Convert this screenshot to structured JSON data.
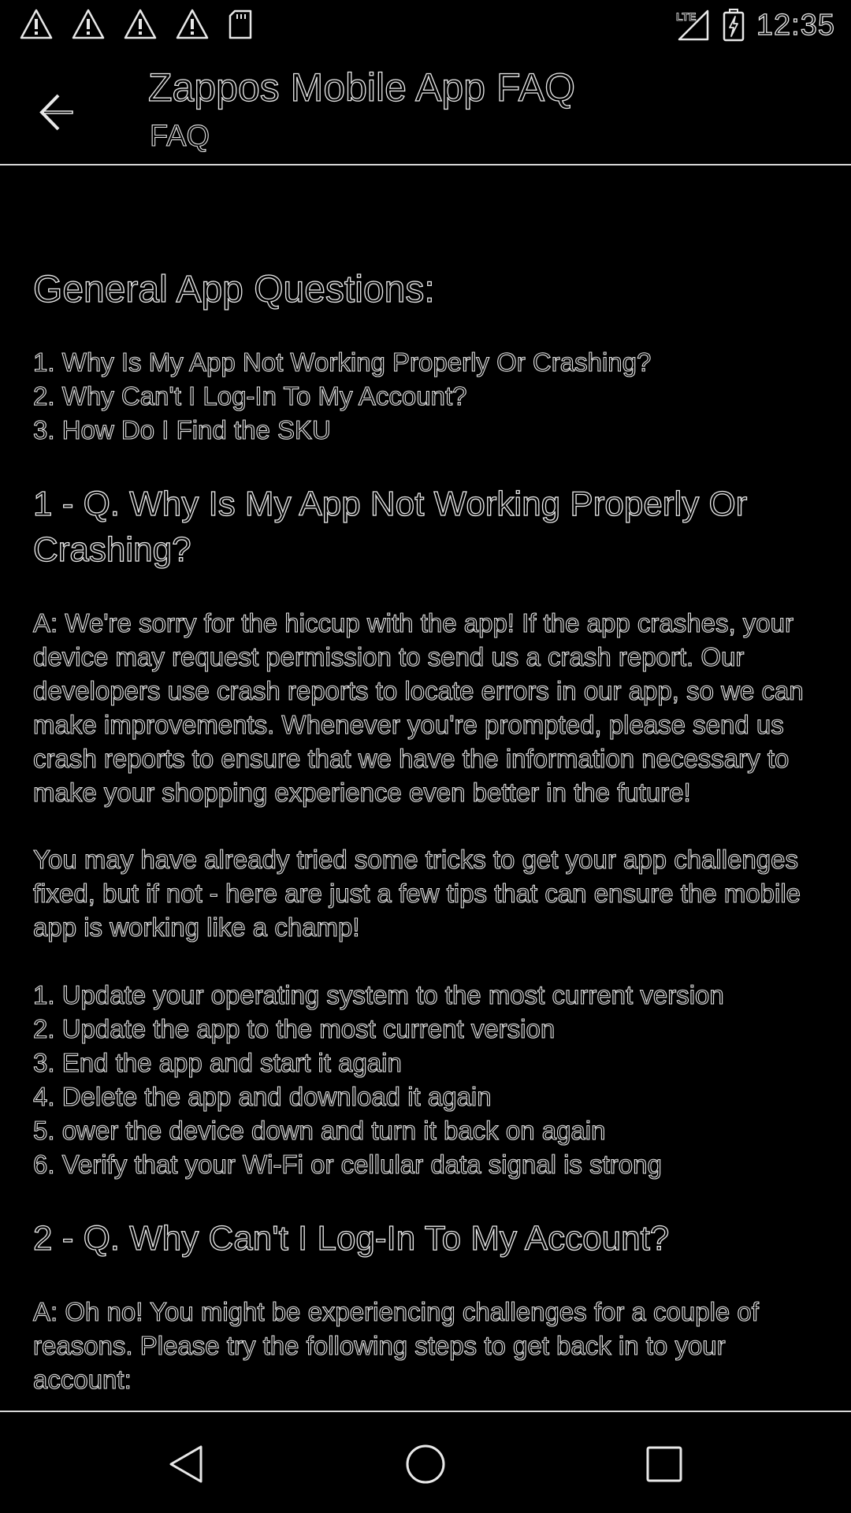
{
  "status_bar": {
    "time": "12:35",
    "notification_icons": [
      "warning-icon",
      "warning-icon",
      "warning-icon",
      "warning-icon",
      "sd-card-icon"
    ],
    "signal_label": "LTE"
  },
  "app_bar": {
    "title": "Zappos Mobile App FAQ",
    "subtitle": "FAQ"
  },
  "content": {
    "section_title": "General App Questions:",
    "toc": [
      "1. Why Is My App Not Working Properly Or Crashing?",
      "2. Why Can't I Log-In To My Account?",
      "3. How Do I Find the SKU"
    ],
    "q1": {
      "title": "1 - Q. Why Is My App Not Working Properly Or Crashing?",
      "answer_1": "A: We're sorry for the hiccup with the app! If the app crashes, your device may request permission to send us a crash report. Our developers use crash reports to locate errors in our app, so we can make improvements. Whenever you're prompted, please send us crash reports to ensure that we have the information necessary to make your shopping experience even better in the future!",
      "answer_2": "You may have already tried some tricks to get your app challenges fixed, but if not - here are just a few tips that can ensure the mobile app is working like a champ!",
      "tips": [
        "1. Update your operating system to the most current version",
        "2. Update the app to the most current version",
        "3. End the app and start it again",
        "4. Delete the app and download it again",
        "5. ower the device down and turn it back on again",
        "6. Verify that your Wi-Fi or cellular data signal is strong"
      ]
    },
    "q2": {
      "title": "2 - Q. Why Can't I Log-In To My Account?",
      "answer_1": "A: Oh no! You might be experiencing challenges for a couple of reasons. Please try the following steps to get back in to your account:"
    }
  },
  "nav_bar": {
    "buttons": [
      "back-triangle-icon",
      "home-circle-icon",
      "recents-square-icon"
    ]
  }
}
